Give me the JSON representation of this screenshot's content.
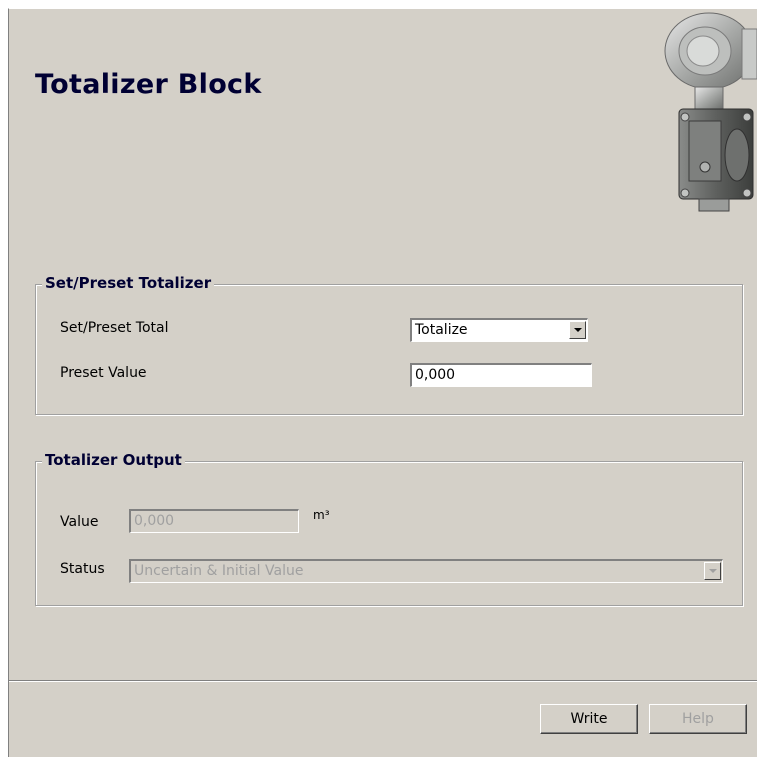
{
  "page": {
    "title": "Totalizer Block"
  },
  "set_preset_group": {
    "legend": "Set/Preset Totalizer",
    "set_preset_total_label": "Set/Preset Total",
    "set_preset_total_value": "Totalize",
    "preset_value_label": "Preset Value",
    "preset_value": "0,000"
  },
  "output_group": {
    "legend": "Totalizer Output",
    "value_label": "Value",
    "value": "0,000",
    "unit": "m³",
    "status_label": "Status",
    "status_value": "Uncertain & Initial Value"
  },
  "buttons": {
    "write_label": "Write",
    "help_label": "Help"
  },
  "colors": {
    "panel_background": "#d4d0c8",
    "title_color": "#000033",
    "disabled_text": "#a0a0a0"
  },
  "icons": {
    "device_image": "pressure-transmitter-icon"
  }
}
